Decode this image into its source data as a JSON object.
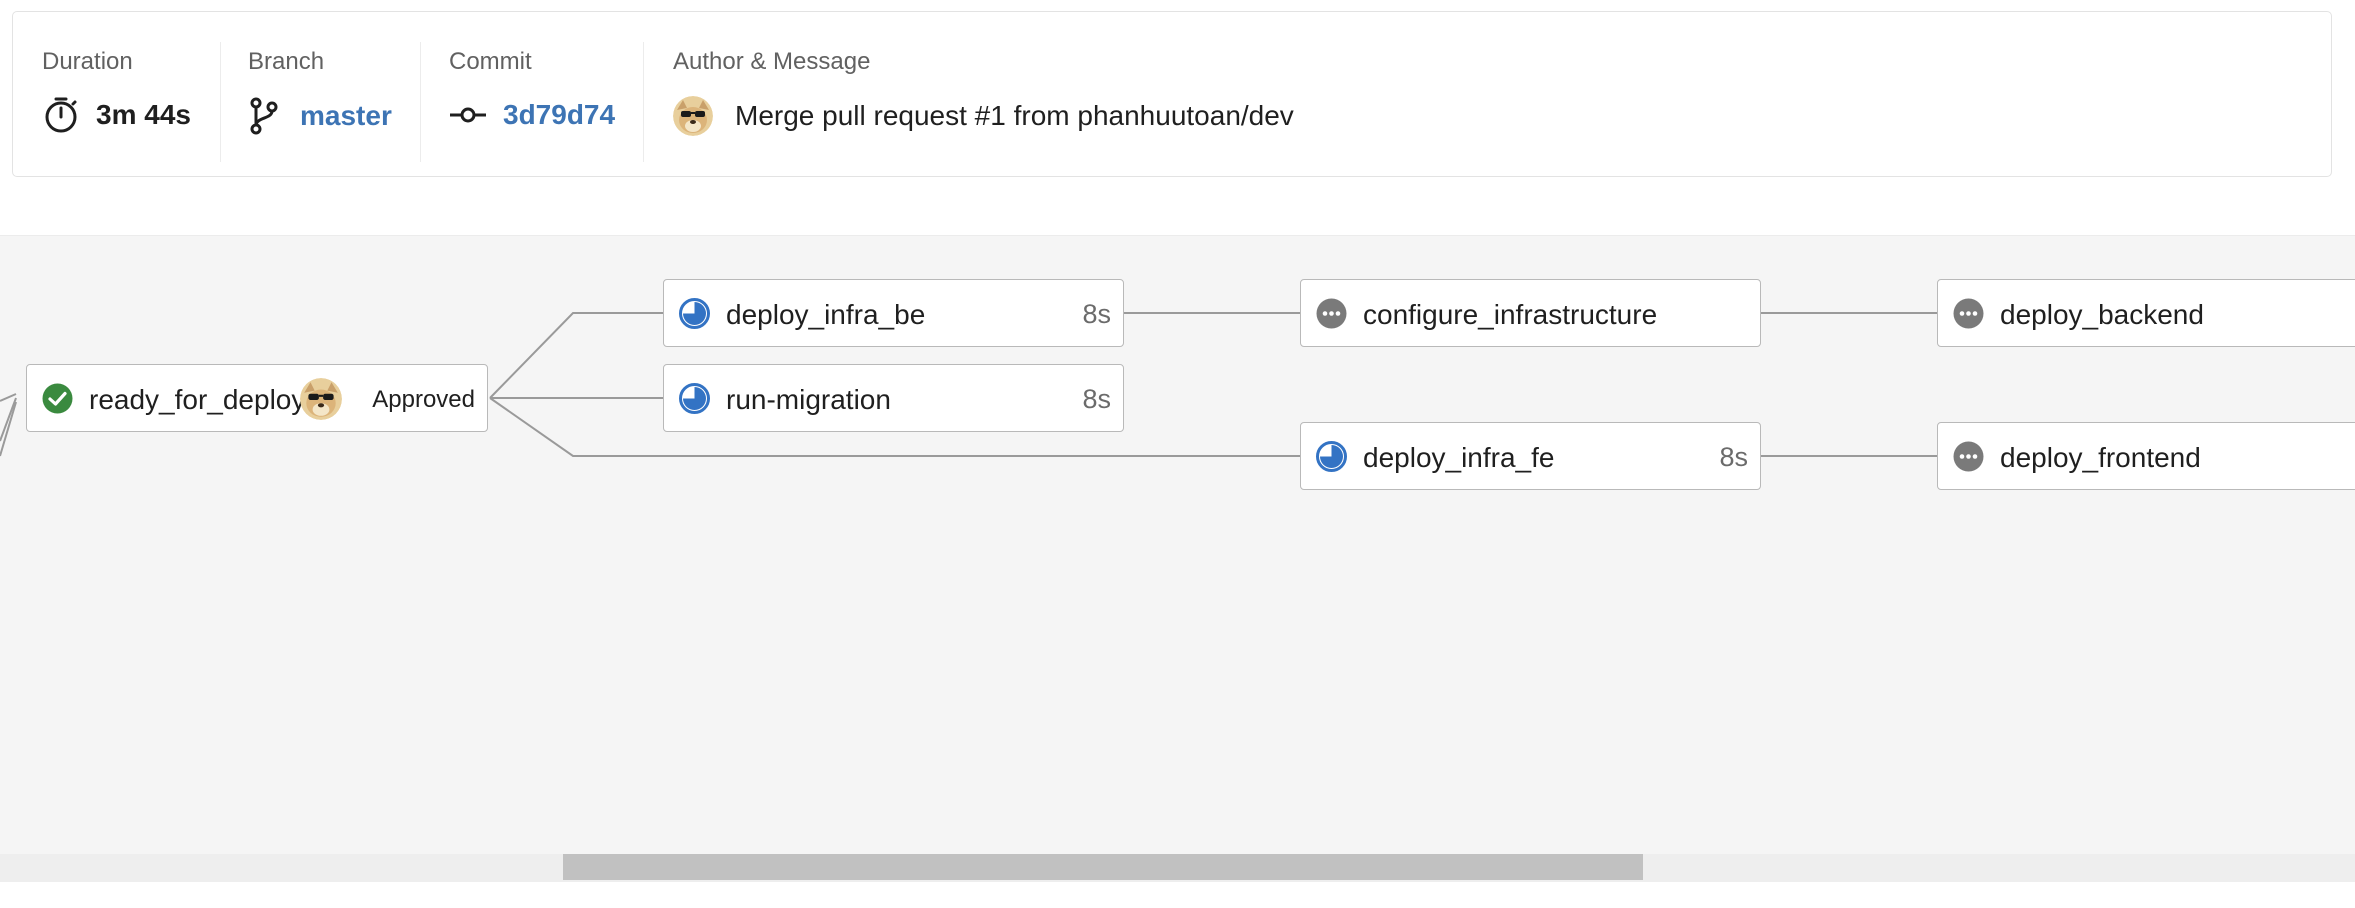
{
  "summary": {
    "duration": {
      "label": "Duration",
      "value": "3m 44s",
      "icon": "stopwatch-icon"
    },
    "branch": {
      "label": "Branch",
      "value": "master",
      "icon": "git-branch-icon"
    },
    "commit": {
      "label": "Commit",
      "value": "3d79d74",
      "icon": "git-commit-icon"
    },
    "author": {
      "label": "Author & Message",
      "message": "Merge pull request #1 from phanhuutoan/dev",
      "icon": "avatar-doge"
    }
  },
  "colors": {
    "link": "#3d74b4",
    "success": "#3a8a3f",
    "running": "#3373c4",
    "pending": "#7a7a7a"
  },
  "jobs": {
    "ready_for_deploy": {
      "name": "ready_for_deploy",
      "status": "success",
      "badge": "Approved"
    },
    "deploy_infra_be": {
      "name": "deploy_infra_be",
      "status": "running",
      "duration": "8s"
    },
    "run_migration": {
      "name": "run-migration",
      "status": "running",
      "duration": "8s"
    },
    "deploy_infra_fe": {
      "name": "deploy_infra_fe",
      "status": "running",
      "duration": "8s"
    },
    "configure_infrastructure": {
      "name": "configure_infrastructure",
      "status": "pending"
    },
    "deploy_backend": {
      "name": "deploy_backend",
      "status": "pending"
    },
    "deploy_frontend": {
      "name": "deploy_frontend",
      "status": "pending"
    }
  }
}
